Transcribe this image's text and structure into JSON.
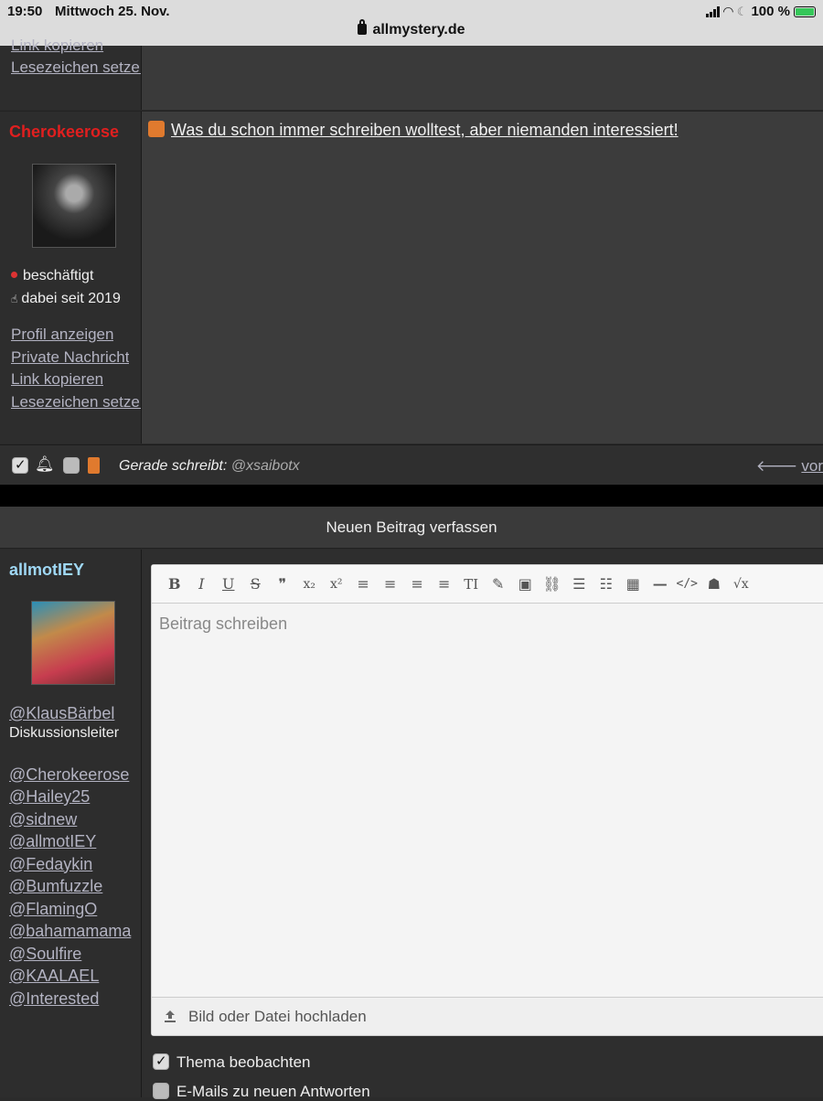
{
  "statusbar": {
    "time": "19:50",
    "date": "Mittwoch 25. Nov.",
    "battery": "100 %",
    "url": "allmystery.de"
  },
  "post1": {
    "links": [
      "Link kopieren",
      "Lesezeichen setzen"
    ]
  },
  "post2": {
    "username": "Cherokeerose",
    "status": "beschäftigt",
    "member_since": "dabei seit 2019",
    "links": [
      "Profil anzeigen",
      "Private Nachricht",
      "Link kopieren",
      "Lesezeichen setzen"
    ],
    "title": "Was du schon immer schreiben wolltest, aber niemanden interessiert!"
  },
  "typing_bar": {
    "label": "Gerade schreibt:",
    "who": "@xsaibotx",
    "prev": "vor"
  },
  "compose": {
    "header": "Neuen Beitrag verfassen",
    "username": "allmotIEY",
    "moderator": "@KlausBärbel",
    "role": "Diskussionsleiter",
    "participants": [
      "@Cherokeerose",
      "@Hailey25",
      "@sidnew",
      "@allmotIEY",
      "@Fedaykin",
      "@Bumfuzzle",
      "@FlamingO",
      "@bahamamama",
      "@Soulfire",
      "@KAALAEL",
      "@Interested"
    ],
    "placeholder": "Beitrag schreiben",
    "upload": "Bild oder Datei hochladen",
    "options": [
      "Thema beobachten",
      "E-Mails zu neuen Antworten"
    ]
  },
  "editor_tools": [
    "B",
    "I",
    "U",
    "S",
    "❞",
    "x₂",
    "x²",
    "≡",
    "≡",
    "≡",
    "≡",
    "TI",
    "✎",
    "▣",
    "⛓",
    "☰",
    "☷",
    "▦",
    "—",
    "</>",
    "☗",
    "√x"
  ]
}
